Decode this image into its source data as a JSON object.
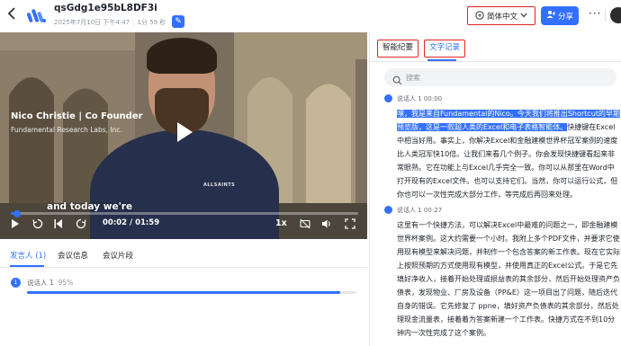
{
  "header": {
    "title": "qsGdg1e95bL8DF3i",
    "date": "2025年7月10日 下午4:47",
    "duration": "1分 59 秒",
    "language_button": "简体中文",
    "share_button": "分享",
    "more": "···"
  },
  "video": {
    "overlay_name": "Nico Christie | Co Founder",
    "overlay_org": "Fundamental Research Labs, Inc.",
    "subtitle": "and today we're",
    "time": "00:02 / 01:59",
    "speed": "1x",
    "progress": 0.017,
    "shirt_text": "ALLSAINTS"
  },
  "left_tabs": {
    "items": [
      "发言人 (1)",
      "会议信息",
      "会议片段"
    ],
    "active_index": 0
  },
  "speakers": [
    {
      "num": "1",
      "name": "说话人 1",
      "percent": "95%",
      "share": 0.95
    }
  ],
  "right_panel": {
    "tabs": [
      "智能纪要",
      "文字记录"
    ],
    "active_index": 1,
    "search_placeholder": "搜索",
    "entries": [
      {
        "speaker": "说话人 1",
        "time": "00:00",
        "highlight": "嘿，我是来自Fundamental的Nico。今天我们将推出Shortcut的早期预览版，这是一款超人类的Excel和电子表格智能体。",
        "text": "快捷键在Excel中相当好用。事实上，你解决Excel和金融建模世界杯冠军案例的速度比人类冠军快10倍。让我们来看几个例子。你会发现快捷键看起来非常眼熟。它在功能上与Excel几乎完全一致。你可以从那里在Word中打开现有的Excel文件。也可以支持它们。当然，你可以运行公式，但你也可以一次性完成大部分工作，等完成后再回来处理。"
      },
      {
        "speaker": "说话人 1",
        "time": "00:27",
        "highlight": "",
        "text": "这里有一个快捷方法，可以解决Excel中最难的问题之一，即金融建模世界杯案例。这大约需要一个小时。我附上多个PDF文件，并要求它使用现有模型来解决问题，并制作一个包含答案的新工作表。现在它实际上按照预期的方式使用现有模型，并使用真正的Excel公式。于是它先填好净收入，接着开始处理或损益表的其余部分，然后开始处理资产负债表，发现物业、厂房及设备（PP&E）这一项目出了问题，随后迭代自身的错误。它先修复了 ppne，填好资产负债表的其余部分，然后处理现金流量表，接着着为答案新建一个工作表。快捷方式在不到10分钟内一次性完成了这个案例。"
      }
    ]
  },
  "colors": {
    "accent": "#3370ff",
    "annotation_red": "#e02424"
  }
}
